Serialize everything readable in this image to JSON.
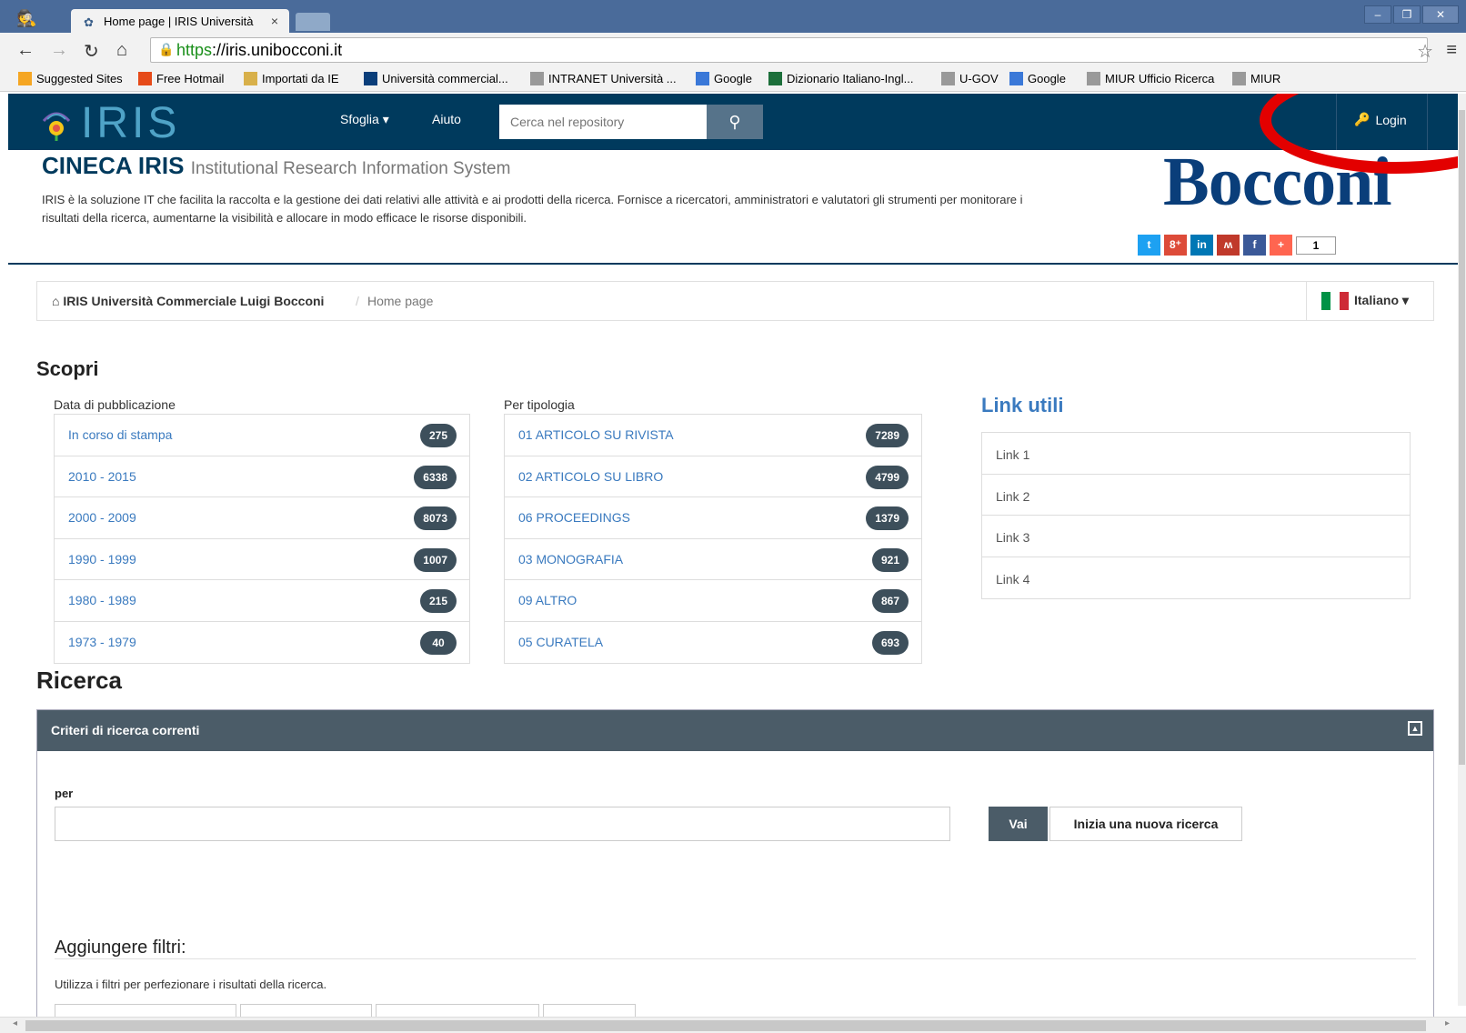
{
  "browser": {
    "tab_title": "Home page | IRIS Università",
    "tab_close": "×",
    "url_scheme": "https",
    "url_rest": "://iris.unibocconi.it",
    "bookmarks": [
      {
        "label": "Suggested Sites",
        "color": "#f5a623"
      },
      {
        "label": "Free Hotmail",
        "color": "#e64a19"
      },
      {
        "label": "Importati da IE",
        "color": "#d8b04a"
      },
      {
        "label": "Università commercial...",
        "color": "#0a3e7a"
      },
      {
        "label": "INTRANET  Università ...",
        "color": "#999999"
      },
      {
        "label": "Google",
        "color": "#3a78d8"
      },
      {
        "label": "Dizionario Italiano-Ingl...",
        "color": "#1c6f3a"
      },
      {
        "label": "U-GOV",
        "color": "#999999"
      },
      {
        "label": "Google",
        "color": "#3a78d8"
      },
      {
        "label": "MIUR Ufficio Ricerca",
        "color": "#999999"
      },
      {
        "label": "MIUR",
        "color": "#999999"
      }
    ]
  },
  "nav": {
    "logo": "IRIS",
    "sfoglia": "Sfoglia ▾",
    "aiuto": "Aiuto",
    "search_placeholder": "Cerca nel repository",
    "login": "Login"
  },
  "header": {
    "title": "CINECA IRIS",
    "subtitle": "Institutional Research Information System",
    "description": "IRIS è la soluzione IT che facilita la raccolta e la gestione dei dati relativi alle attività e ai prodotti della ricerca. Fornisce a ricercatori, amministratori e valutatori gli strumenti per monitorare i risultati della ricerca, aumentarne la visibilità e allocare in modo efficace le risorse disponibili.",
    "brand": "Bocconi",
    "share_count": "1"
  },
  "breadcrumb": {
    "home": "IRIS Università Commerciale Luigi Bocconi",
    "sep": "/",
    "current": "Home page",
    "language": "Italiano ▾"
  },
  "scopri": {
    "title": "Scopri",
    "date_label": "Data di pubblicazione",
    "date_items": [
      {
        "label": "In corso di stampa",
        "count": "275"
      },
      {
        "label": "2010 - 2015",
        "count": "6338"
      },
      {
        "label": "2000 - 2009",
        "count": "8073"
      },
      {
        "label": "1990 - 1999",
        "count": "1007"
      },
      {
        "label": "1980 - 1989",
        "count": "215"
      },
      {
        "label": "1973 - 1979",
        "count": "40"
      }
    ],
    "type_label": "Per tipologia",
    "type_items": [
      {
        "label": "01 ARTICOLO SU RIVISTA",
        "count": "7289"
      },
      {
        "label": "02 ARTICOLO SU LIBRO",
        "count": "4799"
      },
      {
        "label": "06 PROCEEDINGS",
        "count": "1379"
      },
      {
        "label": "03 MONOGRAFIA",
        "count": "921"
      },
      {
        "label": "09 ALTRO",
        "count": "867"
      },
      {
        "label": "05 CURATELA",
        "count": "693"
      }
    ]
  },
  "links": {
    "title": "Link utili",
    "items": [
      "Link 1",
      "Link 2",
      "Link 3",
      "Link 4"
    ]
  },
  "ricerca": {
    "title": "Ricerca",
    "panel_title": "Criteri di ricerca correnti",
    "per_label": "per",
    "vai": "Vai",
    "nuova": "Inizia una nuova ricerca",
    "filters_title": "Aggiungere filtri:",
    "filters_help": "Utilizza i filtri per perfezionare i risultati della ricerca."
  }
}
